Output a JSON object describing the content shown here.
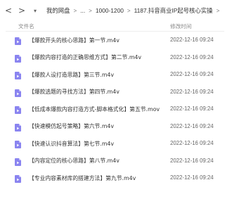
{
  "nav": {
    "back_icon": "<",
    "forward_icon": ">",
    "dropdown_icon": "▾"
  },
  "breadcrumb": {
    "items": [
      "我的网盘",
      "...",
      "1000-1200",
      "1187.抖音商业IP起号核心实操"
    ],
    "separator": ">"
  },
  "columns": {
    "name": "文件名",
    "date": "修改时间"
  },
  "colors": {
    "file_icon": "#8a84f0",
    "text": "#333333",
    "muted": "#888888"
  },
  "files": [
    {
      "name": "【爆款开头的核心思路】第一节.m4v",
      "date": "2022-12-16 09:24",
      "icon": "video-file-icon"
    },
    {
      "name": "【爆款内容打造的正确思维方式】第二节.m4v",
      "date": "2022-12-16 09:24",
      "icon": "video-file-icon"
    },
    {
      "name": "【爆款人设打造思路】第三节.m4v",
      "date": "2022-12-16 09:24",
      "icon": "video-file-icon"
    },
    {
      "name": "【爆款选题的寻找方法】第四节.m4v",
      "date": "2022-12-16 09:24",
      "icon": "video-file-icon"
    },
    {
      "name": "【低成本爆款内容打造方式-脚本格式化】第五节.mov",
      "date": "2022-12-16 09:24",
      "icon": "video-file-icon"
    },
    {
      "name": "【快速模仿起号策略】第六节.m4v",
      "date": "2022-12-16 09:24",
      "icon": "video-file-icon"
    },
    {
      "name": "【快速认识抖音算法】第七节.m4v",
      "date": "2022-12-16 09:24",
      "icon": "video-file-icon"
    },
    {
      "name": "【内容定位的核心思路】第八节.m4v",
      "date": "2022-12-16 09:24",
      "icon": "video-file-icon"
    },
    {
      "name": "【专业内容素材库的搭建方法】第九节.m4v",
      "date": "2022-12-16 09:24",
      "icon": "video-file-icon"
    }
  ]
}
